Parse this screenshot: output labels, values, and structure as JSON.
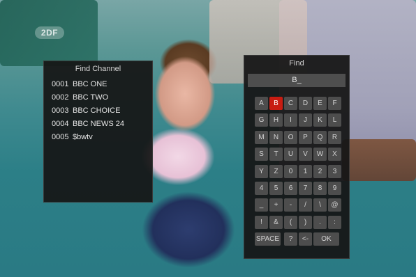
{
  "channel_logo": "2DF",
  "find_channel": {
    "title": "Find Channel",
    "channels": [
      {
        "number": "0001",
        "name": "BBC ONE"
      },
      {
        "number": "0002",
        "name": "BBC TWO"
      },
      {
        "number": "0003",
        "name": "BBC CHOICE"
      },
      {
        "number": "0004",
        "name": "BBC NEWS 24"
      },
      {
        "number": "0005",
        "name": "$bwtv"
      }
    ]
  },
  "find_keyboard": {
    "title": "Find",
    "input_value": "B_",
    "selected_key": "B",
    "rows": [
      [
        "A",
        "B",
        "C",
        "D",
        "E",
        "F"
      ],
      [
        "G",
        "H",
        "I",
        "J",
        "K",
        "L"
      ],
      [
        "M",
        "N",
        "O",
        "P",
        "Q",
        "R"
      ],
      [
        "S",
        "T",
        "U",
        "V",
        "W",
        "X"
      ],
      [
        "Y",
        "Z",
        "0",
        "1",
        "2",
        "3"
      ],
      [
        "4",
        "5",
        "6",
        "7",
        "8",
        "9"
      ],
      [
        "_",
        "+",
        "-",
        "/",
        "\\",
        "@"
      ],
      [
        "!",
        "&",
        "(",
        ")",
        ".",
        ":"
      ],
      [
        "SPACE",
        "?",
        "<-",
        "OK"
      ]
    ]
  },
  "colors": {
    "selected_key": "#c81c12",
    "panel_bg": "#161616"
  }
}
